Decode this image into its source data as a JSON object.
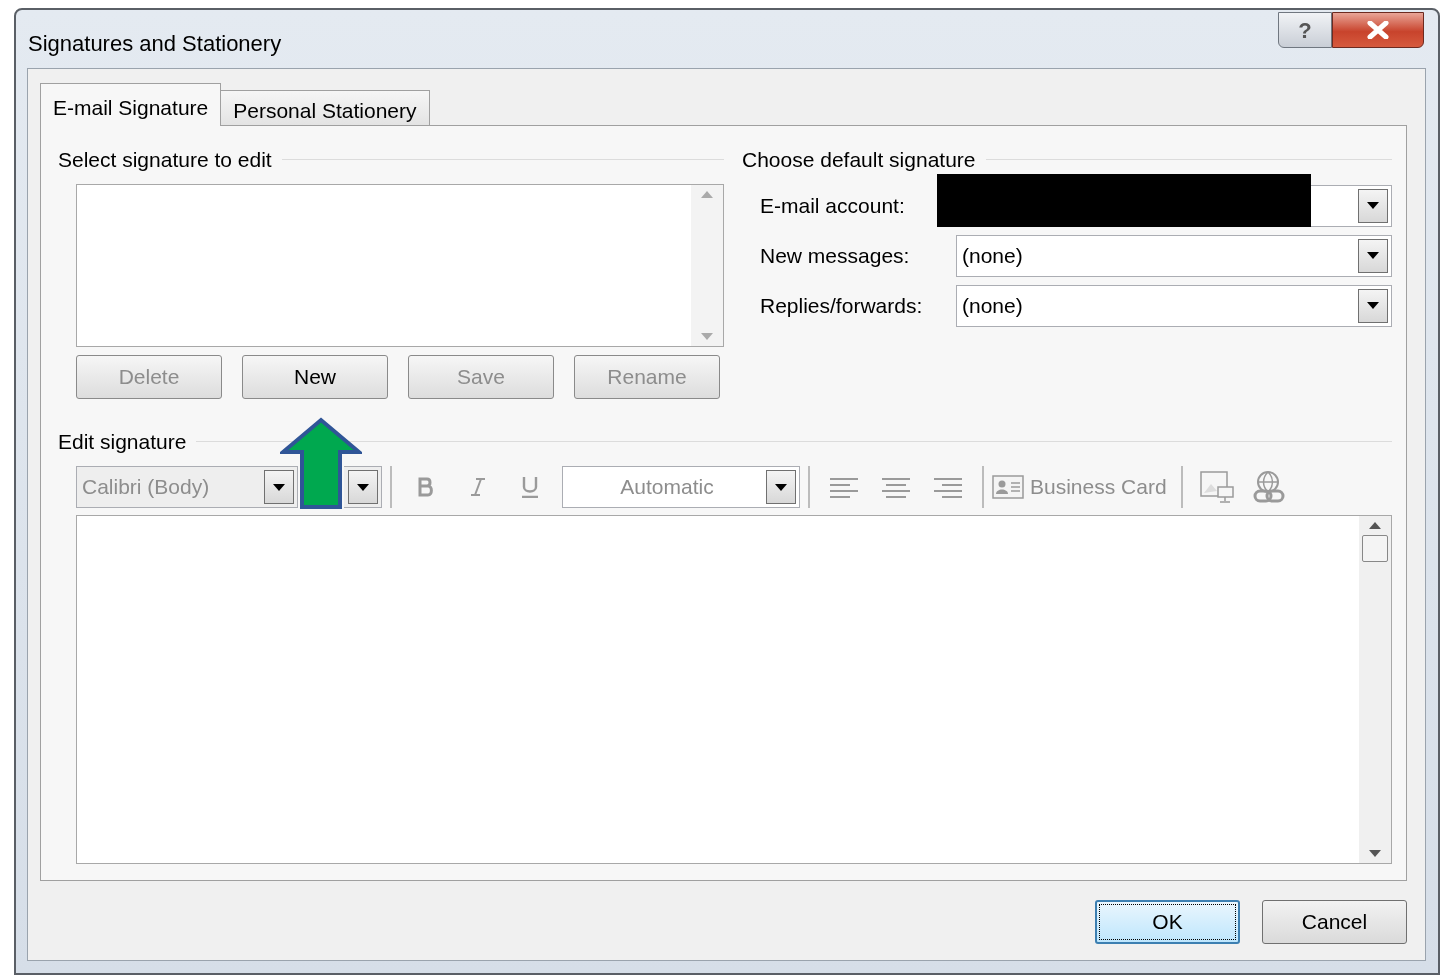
{
  "window": {
    "title": "Signatures and Stationery",
    "help_label": "?"
  },
  "tabs": [
    {
      "label": "E-mail Signature",
      "selected": true
    },
    {
      "label": "Personal Stationery",
      "selected": false
    }
  ],
  "select_signature": {
    "heading": "Select signature to edit",
    "buttons": [
      {
        "label": "Delete",
        "disabled": true
      },
      {
        "label": "New",
        "disabled": false
      },
      {
        "label": "Save",
        "disabled": true
      },
      {
        "label": "Rename",
        "disabled": true
      }
    ]
  },
  "default_signature": {
    "heading": "Choose default signature",
    "fields": [
      {
        "label": "E-mail account:",
        "redacted": true
      },
      {
        "label": "New messages:",
        "value": "(none)"
      },
      {
        "label": "Replies/forwards:",
        "value": "(none)"
      }
    ]
  },
  "edit_signature": {
    "heading": "Edit signature",
    "toolbar": {
      "disabled": true,
      "font": "Calibri (Body)",
      "font_color_label": "Automatic",
      "business_card": "Business Card"
    }
  },
  "buttons": [
    {
      "label": "OK",
      "default": true
    },
    {
      "label": "Cancel",
      "default": false
    }
  ]
}
